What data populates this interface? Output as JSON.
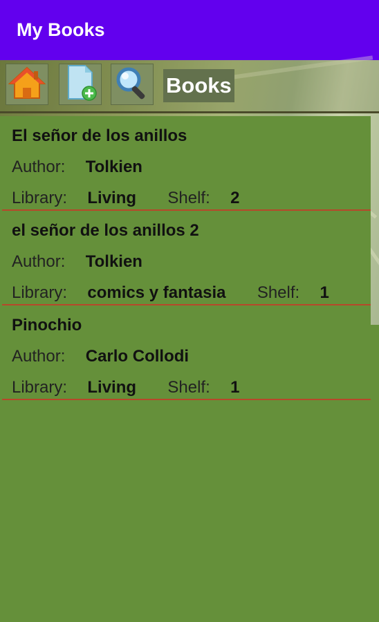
{
  "app_bar": {
    "title": "My Books"
  },
  "toolbar": {
    "buttons": [
      {
        "icon": "home-icon"
      },
      {
        "icon": "add-document-icon"
      },
      {
        "icon": "search-icon"
      }
    ],
    "title": "Books"
  },
  "labels": {
    "author": "Author:",
    "library": "Library:",
    "shelf": "Shelf:"
  },
  "books": [
    {
      "title": "El señor de los anillos",
      "author": "Tolkien",
      "library": "Living",
      "shelf": "2"
    },
    {
      "title": "el señor de los anillos 2",
      "author": "Tolkien",
      "library": "comics y fantasia",
      "shelf": "1"
    },
    {
      "title": "Pinochio",
      "author": "Carlo Collodi",
      "library": "Living",
      "shelf": "1"
    }
  ],
  "colors": {
    "app_bar": "#6200ee",
    "list_bg": "#65903a",
    "divider": "#b7472a"
  }
}
